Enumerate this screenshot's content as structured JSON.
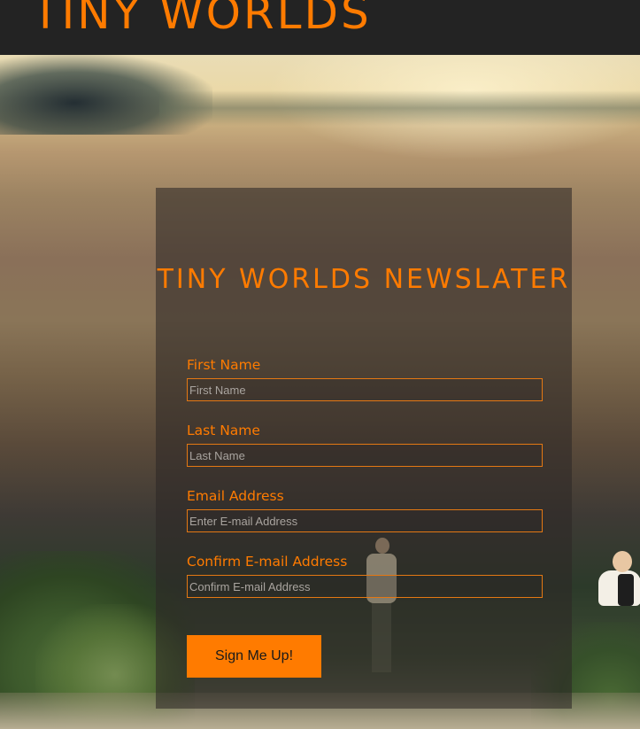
{
  "header": {
    "site_title": "TINY WORLDS"
  },
  "form": {
    "title": "TINY WORLDS NEWSLATER",
    "fields": [
      {
        "label": "First Name",
        "placeholder": "First Name",
        "value": ""
      },
      {
        "label": "Last Name",
        "placeholder": "Last Name",
        "value": ""
      },
      {
        "label": "Email Address",
        "placeholder": "Enter E-mail Address",
        "value": ""
      },
      {
        "label": "Confirm E-mail Address",
        "placeholder": "Confirm E-mail Address",
        "value": ""
      }
    ],
    "submit_label": "Sign Me Up!"
  },
  "colors": {
    "accent": "#ff7b00",
    "header_bg": "#232323",
    "panel_bg": "rgba(45,40,38,0.58)"
  }
}
